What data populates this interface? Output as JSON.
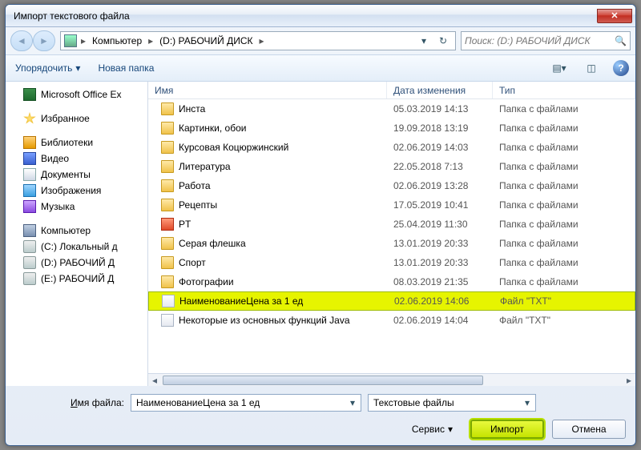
{
  "title": "Импорт текстового файла",
  "nav": {
    "segments": [
      "Компьютер",
      "(D:) РАБОЧИЙ ДИСК"
    ],
    "search_placeholder": "Поиск: (D:) РАБОЧИЙ ДИСК"
  },
  "toolbar": {
    "organize": "Упорядочить",
    "new_folder": "Новая папка"
  },
  "tree": {
    "excel": "Microsoft Office Ex",
    "favorites": "Избранное",
    "libraries": "Библиотеки",
    "video": "Видео",
    "documents": "Документы",
    "pictures": "Изображения",
    "music": "Музыка",
    "computer": "Компьютер",
    "drive_c": "(C:) Локальный д",
    "drive_d": "(D:) РАБОЧИЙ Д",
    "drive_e": "(E:) РАБОЧИЙ Д"
  },
  "columns": {
    "name": "Имя",
    "date": "Дата изменения",
    "type": "Тип"
  },
  "rows": [
    {
      "icon": "folder",
      "name": "Инста",
      "date": "05.03.2019 14:13",
      "type": "Папка с файлами"
    },
    {
      "icon": "folder",
      "name": "Картинки, обои",
      "date": "19.09.2018 13:19",
      "type": "Папка с файлами"
    },
    {
      "icon": "folder",
      "name": "Курсовая Коцюржинский",
      "date": "02.06.2019 14:03",
      "type": "Папка с файлами"
    },
    {
      "icon": "folder",
      "name": "Литература",
      "date": "22.05.2018 7:13",
      "type": "Папка с файлами"
    },
    {
      "icon": "folder",
      "name": "Работа",
      "date": "02.06.2019 13:28",
      "type": "Папка с файлами"
    },
    {
      "icon": "folder",
      "name": "Рецепты",
      "date": "17.05.2019 10:41",
      "type": "Папка с файлами"
    },
    {
      "icon": "pt",
      "name": "PT",
      "date": "25.04.2019 11:30",
      "type": "Папка с файлами"
    },
    {
      "icon": "folder",
      "name": "Серая флешка",
      "date": "13.01.2019 20:33",
      "type": "Папка с файлами"
    },
    {
      "icon": "folder",
      "name": "Спорт",
      "date": "13.01.2019 20:33",
      "type": "Папка с файлами"
    },
    {
      "icon": "folder",
      "name": "Фотографии",
      "date": "08.03.2019 21:35",
      "type": "Папка с файлами"
    },
    {
      "icon": "txt",
      "name": "НаименованиеЦена за 1 ед",
      "date": "02.06.2019 14:06",
      "type": "Файл \"TXT\"",
      "selected": true
    },
    {
      "icon": "txt",
      "name": "Некоторые из основных функций Java",
      "date": "02.06.2019 14:04",
      "type": "Файл \"TXT\""
    }
  ],
  "filename": {
    "label_pre": "И",
    "label_rest": "мя файла:",
    "value": "НаименованиеЦена за 1 ед"
  },
  "filter": "Текстовые файлы",
  "service": "Сервис",
  "buttons": {
    "import": "Импорт",
    "cancel": "Отмена"
  }
}
